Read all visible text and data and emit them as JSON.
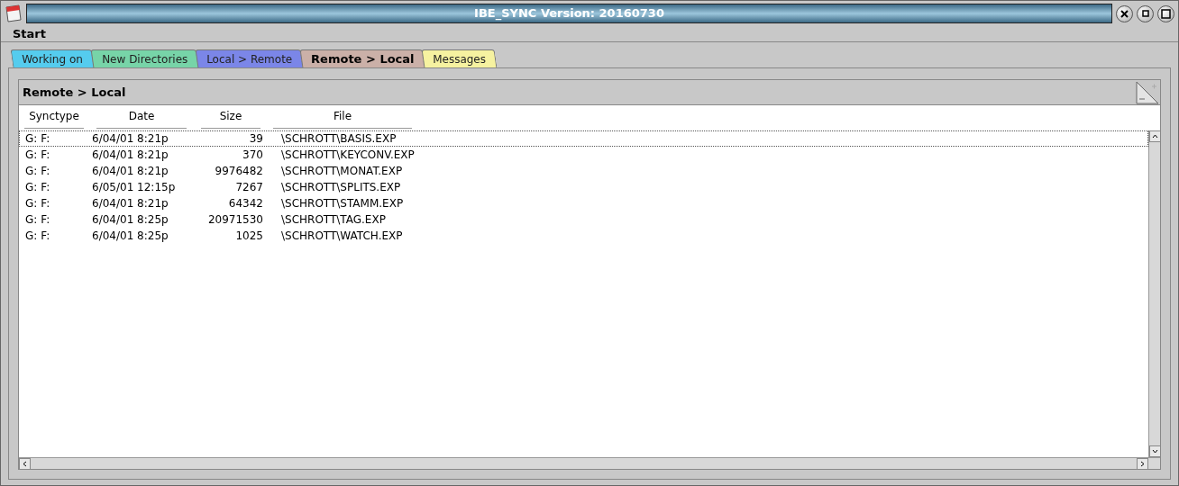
{
  "window": {
    "title": "IBE_SYNC Version: 20160730"
  },
  "menu": [
    "Start"
  ],
  "tabs": [
    {
      "label": "Working on",
      "selected": false,
      "color": "#55ccee"
    },
    {
      "label": "New Directories",
      "selected": false,
      "color": "#77d4a8"
    },
    {
      "label": "Local > Remote",
      "selected": false,
      "color": "#7b86e8"
    },
    {
      "label": "Remote > Local",
      "selected": true,
      "color": "#cbb0a8"
    },
    {
      "label": "Messages",
      "selected": false,
      "color": "#f6f2a0"
    }
  ],
  "panel": {
    "title": "Remote > Local"
  },
  "table": {
    "columns": [
      "Synctype",
      "Date",
      "Size",
      "File"
    ],
    "rows": [
      {
        "cells": [
          "G: F:",
          "6/04/01 8:21p",
          "39",
          "\\SCHROTT\\BASIS.EXP"
        ],
        "selected": true
      },
      {
        "cells": [
          "G: F:",
          "6/04/01 8:21p",
          "370",
          "\\SCHROTT\\KEYCONV.EXP"
        ],
        "selected": false
      },
      {
        "cells": [
          "G: F:",
          "6/04/01 8:21p",
          "9976482",
          "\\SCHROTT\\MONAT.EXP"
        ],
        "selected": false
      },
      {
        "cells": [
          "G: F:",
          "6/05/01 12:15p",
          "7267",
          "\\SCHROTT\\SPLITS.EXP"
        ],
        "selected": false
      },
      {
        "cells": [
          "G: F:",
          "6/04/01 8:21p",
          "64342",
          "\\SCHROTT\\STAMM.EXP"
        ],
        "selected": false
      },
      {
        "cells": [
          "G: F:",
          "6/04/01 8:25p",
          "20971530",
          "\\SCHROTT\\TAG.EXP"
        ],
        "selected": false
      },
      {
        "cells": [
          "G: F:",
          "6/04/01 8:25p",
          "1025",
          "\\SCHROTT\\WATCH.EXP"
        ],
        "selected": false
      }
    ]
  }
}
